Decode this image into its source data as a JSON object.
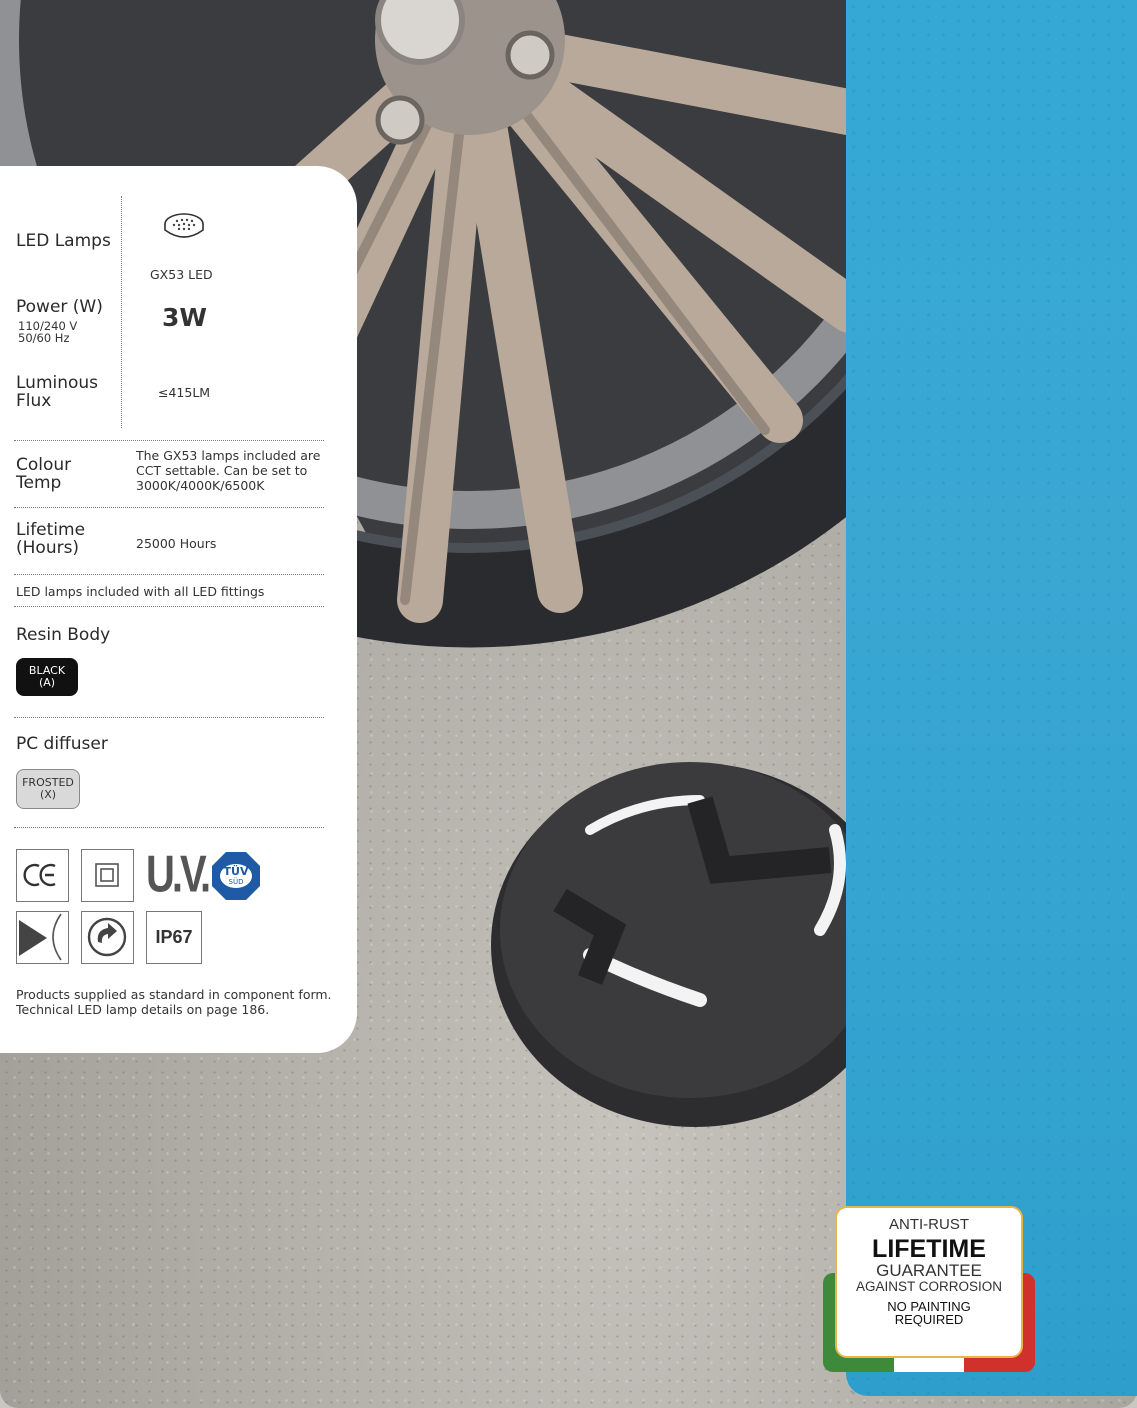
{
  "spec": {
    "led_lamps_label": "LED Lamps",
    "lamp_icon": "led-lamp-icon",
    "lamp_type": "GX53 LED",
    "power_label": "Power (W)",
    "power_sub": "110/240 V\n50/60 Hz",
    "power_value": "3W",
    "flux_label": "Luminous\nFlux",
    "flux_value": "≤415LM",
    "colour_label": "Colour\nTemp",
    "colour_value": "The GX53 lamps included are\nCCT settable.  Can be set to\n3000K/4000K/6500K",
    "lifetime_label": "Lifetime\n(Hours)",
    "lifetime_value": "25000 Hours",
    "included_note": "LED lamps included with all LED fittings",
    "body_label": "Resin Body",
    "body_swatch": "BLACK\n(A)",
    "diffuser_label": "PC diffuser",
    "diffuser_swatch": "FROSTED\n(X)",
    "certifications": [
      "ce-mark-icon",
      "class-ii-icon",
      "uv-resistant-icon",
      "tuv-sud-icon",
      "no-sharp-edge-icon",
      "rotatable-icon",
      "ip67-icon"
    ],
    "cert_tuv_text": "TÜV",
    "cert_tuv_sub": "SÜD",
    "cert_uv_text": "U.V.",
    "cert_ip_text": "IP67",
    "footnote": "Products supplied as standard in component form.\nTechnical LED lamp details on page 186."
  },
  "badge": {
    "line1": "ANTI-RUST",
    "line2": "LIFETIME",
    "line3": "GUARANTEE",
    "line4": "AGAINST CORROSION",
    "line5": "NO PAINTING\nREQUIRED"
  },
  "colors": {
    "blue_band": "#35a8d6",
    "flag_green": "#3f8a3a",
    "flag_white": "#ffffff",
    "flag_red": "#d0312d",
    "badge_border": "#e7b54a"
  }
}
